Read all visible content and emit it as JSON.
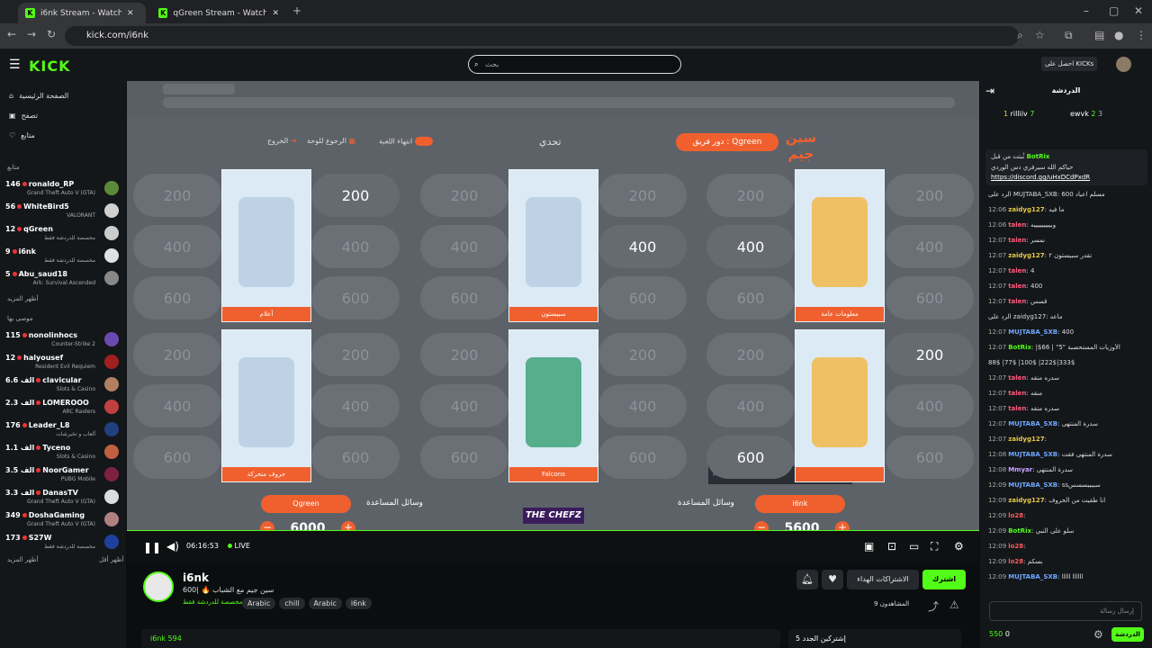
{
  "browser": {
    "tabs": [
      {
        "title": "i6nk Stream - Watch Live on",
        "active": true
      },
      {
        "title": "qGreen Stream - Watch Live on",
        "active": false
      }
    ],
    "url": "kick.com/i6nk"
  },
  "header": {
    "logo": "KICK",
    "search_placeholder": "بحث",
    "get_kicks": "احصل على KICKs"
  },
  "sidebar": {
    "nav": [
      {
        "label": "الصفحة الرئيسية",
        "icon": "home-icon"
      },
      {
        "label": "تصفح",
        "icon": "browse-icon"
      },
      {
        "label": "متابع",
        "icon": "heart-icon"
      }
    ],
    "following_title": "متابع",
    "following": [
      {
        "viewers": "146",
        "name": "ronaldo_RP",
        "game": "Grand Theft Auto V (GTA)",
        "color": "#5a8a3a"
      },
      {
        "viewers": "56",
        "name": "WhiteBird5",
        "game": "VALORANT",
        "color": "#d0d0d0"
      },
      {
        "viewers": "12",
        "name": "qGreen",
        "game": "مخصصة للدردشة فقط",
        "color": "#cccccc"
      },
      {
        "viewers": "9",
        "name": "i6nk",
        "game": "مخصصة للدردشة فقط",
        "color": "#e0e0e0"
      },
      {
        "viewers": "5",
        "name": "Abu_saud18",
        "game": "Ark: Survival Ascended",
        "color": "#888"
      }
    ],
    "show_more": "أظهر المزيد",
    "recommended_title": "موصى بها",
    "recommended": [
      {
        "viewers": "115",
        "name": "nonolinhocs",
        "game": "Counter-Strike 2",
        "color": "#6a4ab0"
      },
      {
        "viewers": "12",
        "name": "halyousef",
        "game": "Resident Evil Requiem",
        "color": "#a02020"
      },
      {
        "viewers": "6.6 الف",
        "name": "clavicular",
        "game": "Slots & Casino",
        "color": "#b08060"
      },
      {
        "viewers": "2.3 الف",
        "name": "LOMEROOO",
        "game": "ARC Raiders",
        "color": "#c04040"
      },
      {
        "viewers": "176",
        "name": "Leader_L8",
        "game": "ألعاب و تخيرشات",
        "color": "#204080"
      },
      {
        "viewers": "1.1 الف",
        "name": "Tyceno",
        "game": "Slots & Casino",
        "color": "#c06040"
      },
      {
        "viewers": "3.5 الف",
        "name": "NoorGamer",
        "game": "PUBG Mobile",
        "color": "#802040"
      },
      {
        "viewers": "3.3 الف",
        "name": "DanasTV",
        "game": "Grand Theft Auto V (GTA)",
        "color": "#ddd"
      },
      {
        "viewers": "349",
        "name": "DoshaGaming",
        "game": "Grand Theft Auto V (GTA)",
        "color": "#b08080"
      },
      {
        "viewers": "173",
        "name": "S27W",
        "game": "مخصصة للدردشة فقط",
        "color": "#2040a0"
      }
    ],
    "show_more2": "أظهر المزيد",
    "show_less": "أظهر أقل"
  },
  "game": {
    "challenge": "تحدي",
    "team_turn": "دور فريق : Qgreen",
    "end_game": "انتهاء اللعبة",
    "back_board": "الرجوع للوحة",
    "exit": "الخروج",
    "points": [
      "200",
      "400",
      "600"
    ],
    "categories": [
      {
        "label": "أعلام",
        "revealed": [
          false,
          false,
          false,
          false,
          false,
          false
        ]
      },
      {
        "label": "سبيستون",
        "revealed": [
          true,
          false,
          false,
          false,
          false,
          false
        ]
      },
      {
        "label": "معلومات عامة",
        "revealed": [
          false,
          false,
          false,
          false,
          false,
          false
        ]
      },
      {
        "label": "حروف متحركة",
        "revealed": [
          false,
          true,
          false,
          false,
          false,
          false
        ]
      },
      {
        "label": "Falcons",
        "revealed": [
          false,
          true,
          false,
          false,
          false,
          true
        ]
      },
      {
        "label": "",
        "revealed": [
          false,
          false,
          false,
          true,
          false,
          false
        ]
      }
    ],
    "aids_label": "وسائل المساعدة",
    "team_left": "Qgreen",
    "score_left": "6000",
    "team_right": "i6nk",
    "score_right": "5600",
    "sponsor": "THE CHEFZ",
    "overlay_user": "MUJTABA_SXB"
  },
  "player": {
    "time": "06:16:53",
    "live": "LIVE"
  },
  "stream": {
    "name": "i6nk",
    "title": "سين جيم مع الشباب 🔥 |600",
    "category": "مخصصة للدردشة فقط",
    "tags": [
      "Arabic",
      "chill",
      "Arabic",
      "i6nk"
    ],
    "followers_btn": "الاشتراكات الهداء",
    "subscribe": "اشترك",
    "viewers_label": "المشاهدون 9",
    "bottom_left": "i6nk 594",
    "bottom_right": "إشتركين الجدد 5"
  },
  "chat": {
    "title": "الدردشة",
    "top": [
      {
        "rank": "1",
        "name": "rilliiv",
        "count": "7"
      },
      {
        "rank": "2",
        "name": "ewvk",
        "count": "3"
      }
    ],
    "pinned_by": "ثُبتت من قبل",
    "pinned_user": "BotRix",
    "pinned_text": "حياكم الله سيرفري دس الوردي",
    "pinned_link": "https://discord.gg/uHxDCdPxdR",
    "messages": [
      {
        "time": "",
        "user": "",
        "color": "#aaa",
        "text": "الرد على MUJTABA_SXB: مسلم اعياد 600"
      },
      {
        "time": "12:06",
        "user": "zaidyg127",
        "color": "#e6c84a",
        "text": "ما فيه"
      },
      {
        "time": "12:06",
        "user": "talen",
        "color": "#ff5a7a",
        "text": "وبيييييييييه"
      },
      {
        "time": "12:07",
        "user": "talen",
        "color": "#ff5a7a",
        "text": "نمسر"
      },
      {
        "time": "12:07",
        "user": "zaidyg127",
        "color": "#e6c84a",
        "text": "تقدر سبيستون ٢"
      },
      {
        "time": "12:07",
        "user": "talen",
        "color": "#ff5a7a",
        "text": "4"
      },
      {
        "time": "12:07",
        "user": "talen",
        "color": "#ff5a7a",
        "text": "400"
      },
      {
        "time": "12:07",
        "user": "talen",
        "color": "#ff5a7a",
        "text": "قسس"
      },
      {
        "time": "",
        "user": "",
        "color": "#aaa",
        "text": "الرد على zaidyg127: ماعه"
      },
      {
        "time": "12:07",
        "user": "MUJTABA_SXB",
        "color": "#6fa8ff",
        "text": "400"
      },
      {
        "time": "12:07",
        "user": "BotRix",
        "color": "#53fc18",
        "text": "|$66 | \"5\" الأوزيات المستحصبة"
      },
      {
        "time": "",
        "user": "",
        "color": "#ddd",
        "text": "88$ |77$ |100$ |222$|333$"
      },
      {
        "time": "12:07",
        "user": "talen",
        "color": "#ff5a7a",
        "text": "سدره منقه"
      },
      {
        "time": "12:07",
        "user": "talen",
        "color": "#ff5a7a",
        "text": "منقه"
      },
      {
        "time": "12:07",
        "user": "talen",
        "color": "#ff5a7a",
        "text": "سدره منقه"
      },
      {
        "time": "12:07",
        "user": "MUJTABA_SXB",
        "color": "#6fa8ff",
        "text": "سدرة المنتهى"
      },
      {
        "time": "12:07",
        "user": "zaidyg127",
        "color": "#e6c84a",
        "text": ""
      },
      {
        "time": "12:08",
        "user": "MUJTABA_SXB",
        "color": "#6fa8ff",
        "text": "سدرة المنتهى فقت"
      },
      {
        "time": "12:08",
        "user": "Mmyar",
        "color": "#c8a0ff",
        "text": "سدرة المنتهى"
      },
      {
        "time": "12:09",
        "user": "MUJTABA_SXB",
        "color": "#6fa8ff",
        "text": "ssسببببسسس"
      },
      {
        "time": "12:09",
        "user": "zaidyg127",
        "color": "#e6c84a",
        "text": "انا طقيت من الحروف"
      },
      {
        "time": "12:09",
        "user": "lo28",
        "color": "#ff5a5a",
        "text": ""
      },
      {
        "time": "12:09",
        "user": "BotRix",
        "color": "#53fc18",
        "text": "سلو على النبي"
      },
      {
        "time": "12:09",
        "user": "lo28",
        "color": "#ff5a5a",
        "text": ""
      },
      {
        "time": "12:09",
        "user": "lo28",
        "color": "#ff5a5a",
        "text": "بسكم"
      },
      {
        "time": "12:09",
        "user": "MUJTABA_SXB",
        "color": "#6fa8ff",
        "text": "اااااا ااااا"
      }
    ],
    "send_placeholder": "إرسال رسالة",
    "points": "550",
    "zero": "0",
    "chat_btn": "الدردشة"
  }
}
